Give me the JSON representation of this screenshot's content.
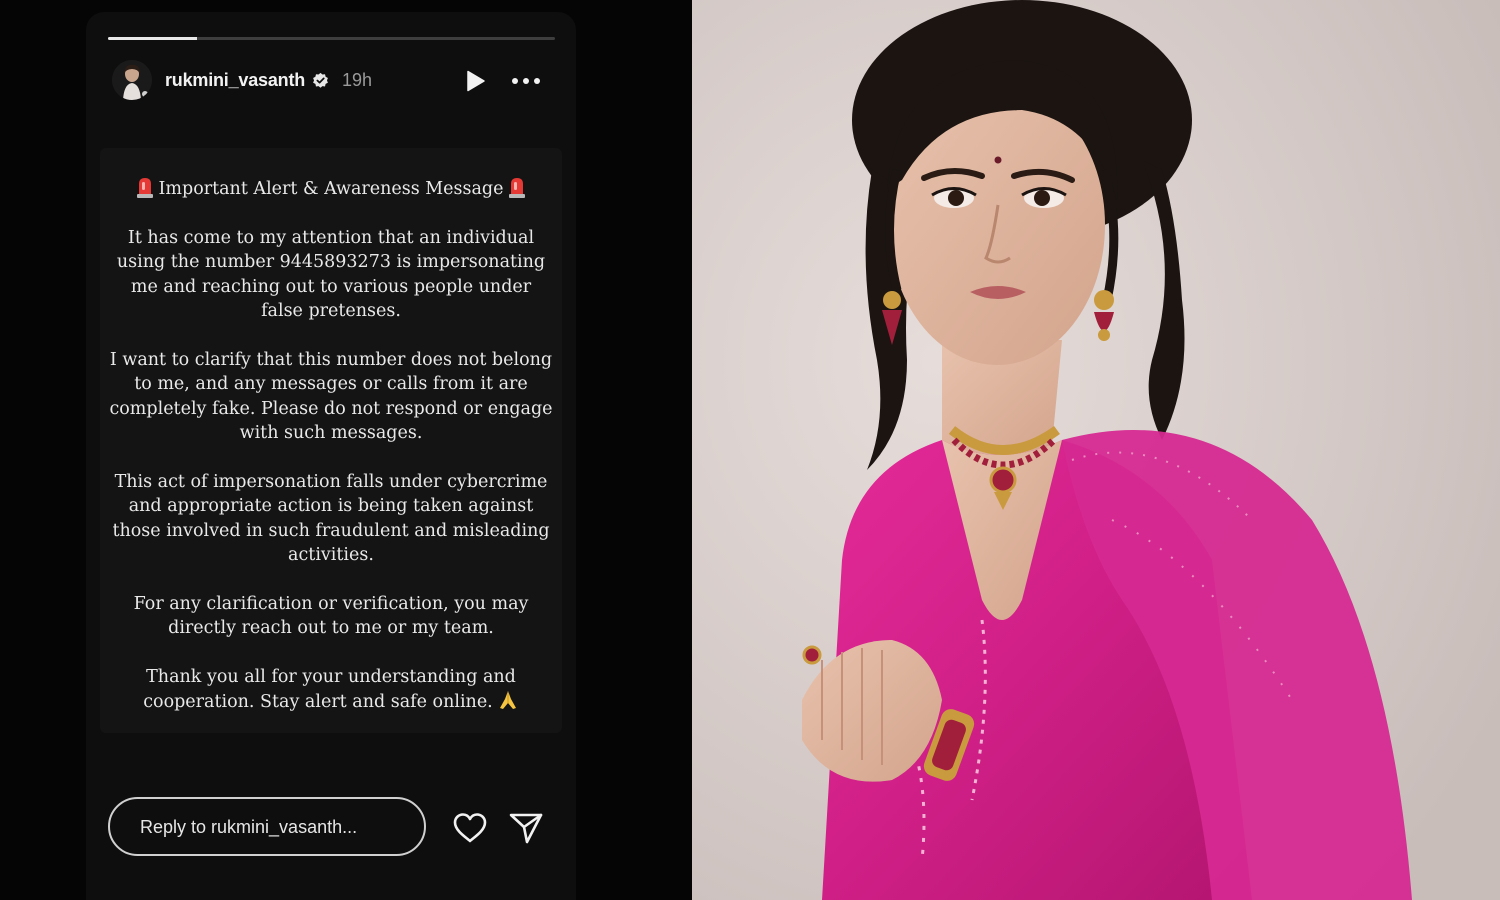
{
  "story": {
    "progress": 0.2,
    "username": "rukmini_vasanth",
    "time": "19h",
    "heading": "Important Alert & Awareness Message",
    "paragraphs": [
      "It has come to my attention that an individual using the number 9445893273 is impersonating me and reaching out to various people under false pretenses.",
      "I want to clarify that this number does not belong to me, and any messages or calls from it are completely fake. Please do not respond or engage with such messages.",
      "This act of impersonation falls under cybercrime and appropriate action is being taken against those involved in such fraudulent and misleading activities.",
      "For any clarification or verification, you may directly reach out to me or my team."
    ],
    "closing": "Thank you all for your understanding and cooperation. Stay alert and safe online.",
    "reply_placeholder": "Reply to rukmini_vasanth..."
  },
  "icons": {
    "verified": "verified-badge-icon",
    "play": "play-icon",
    "more": "more-options-icon",
    "heart": "heart-icon",
    "send": "send-icon",
    "siren": "siren-emoji-icon",
    "pray": "folded-hands-emoji-icon"
  },
  "colors": {
    "background": "#050505",
    "text": "#e9e9e9",
    "muted": "#9a9a9a",
    "photo_backdrop": "#d6ccc8",
    "saree": "#d6208e"
  }
}
